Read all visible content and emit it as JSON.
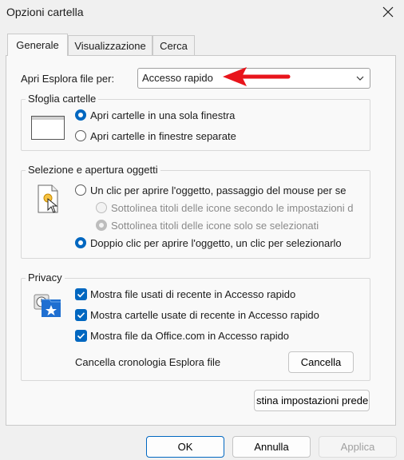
{
  "window": {
    "title": "Opzioni cartella"
  },
  "tabs": [
    {
      "label": "Generale",
      "active": true
    },
    {
      "label": "Visualizzazione",
      "active": false
    },
    {
      "label": "Cerca",
      "active": false
    }
  ],
  "explorer": {
    "label": "Apri Esplora file per:",
    "value": "Accesso rapido"
  },
  "browse": {
    "legend": "Sfoglia cartelle",
    "option_same": "Apri cartelle in una sola finestra",
    "option_separate": "Apri cartelle in finestre separate"
  },
  "click": {
    "legend": "Selezione e apertura oggetti",
    "single": "Un clic per aprire l'oggetto, passaggio del mouse per se",
    "underline_browser": "Sottolinea titoli delle icone secondo le impostazioni d",
    "underline_hover": "Sottolinea titoli delle icone solo se selezionati",
    "double": "Doppio clic per aprire l'oggetto, un clic per selezionarlo"
  },
  "privacy": {
    "legend": "Privacy",
    "recent_files": "Mostra file usati di recente in Accesso rapido",
    "recent_folders": "Mostra cartelle usate di recente in Accesso rapido",
    "office_files": "Mostra file da Office.com in Accesso rapido",
    "clear_label": "Cancella cronologia Esplora file",
    "clear_button": "Cancella"
  },
  "restore_button": "stina impostazioni prede",
  "footer": {
    "ok": "OK",
    "cancel": "Annulla",
    "apply": "Applica"
  },
  "colors": {
    "accent": "#0067c0",
    "arrow": "#e8141b"
  }
}
